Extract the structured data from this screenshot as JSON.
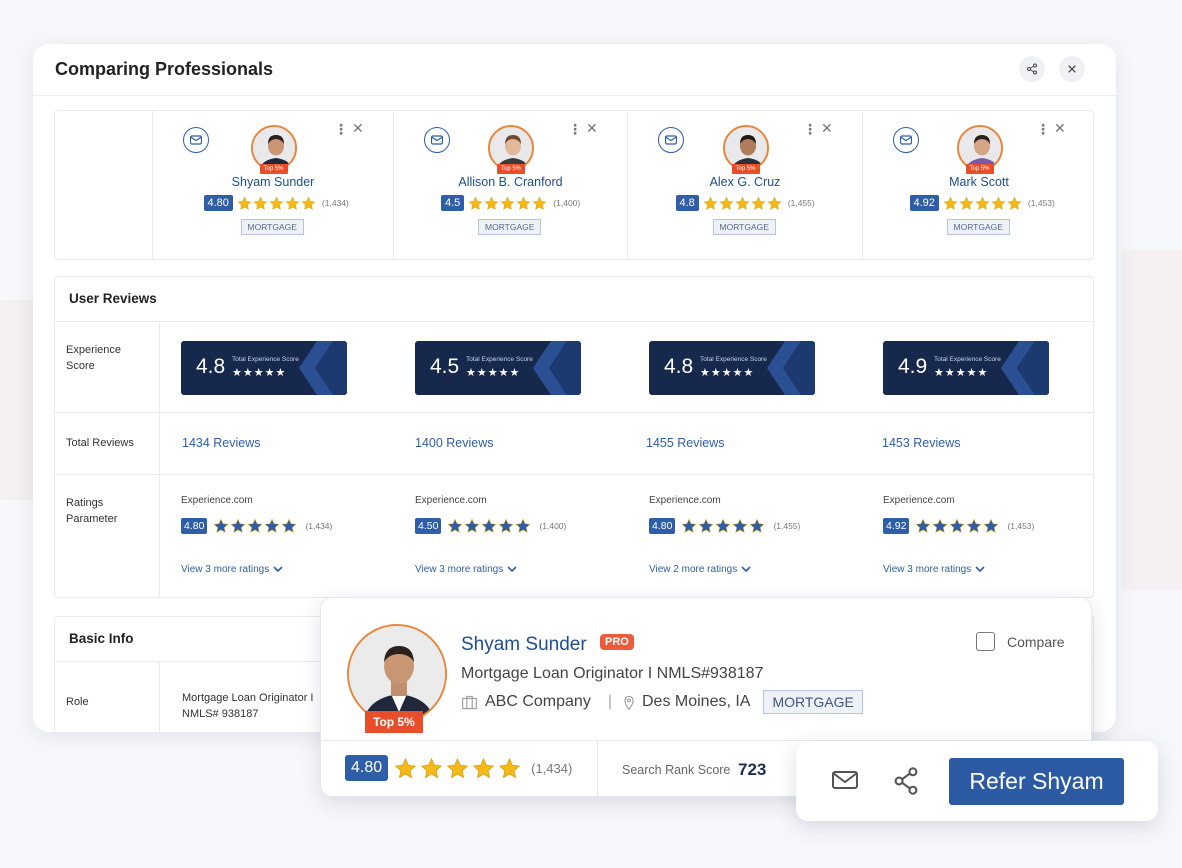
{
  "panel": {
    "title": "Comparing Professionals"
  },
  "colors": {
    "brand_blue": "#2f5ea8",
    "navy": "#16294d",
    "star": "#f5b91a",
    "badge_orange": "#e94e2a"
  },
  "professionals": [
    {
      "name": "Shyam Sunder",
      "badge": "Top 5%",
      "rating": "4.80",
      "reviews_count": "(1,434)",
      "tag": "MORTGAGE",
      "experience_score": "4.8",
      "total_reviews": "1434 Reviews",
      "source": "Experience.com",
      "param_rating": "4.80",
      "param_count": "(1,434)",
      "view_more": "View 3 more ratings"
    },
    {
      "name": "Allison B. Cranford",
      "badge": "Top 5%",
      "rating": "4.5",
      "reviews_count": "(1,400)",
      "tag": "MORTGAGE",
      "experience_score": "4.5",
      "total_reviews": "1400 Reviews",
      "source": "Experience.com",
      "param_rating": "4.50",
      "param_count": "(1,400)",
      "view_more": "View 3 more ratings"
    },
    {
      "name": "Alex G. Cruz",
      "badge": "Top 5%",
      "rating": "4.8",
      "reviews_count": "(1,455)",
      "tag": "MORTGAGE",
      "experience_score": "4.8",
      "total_reviews": "1455 Reviews",
      "source": "Experience.com",
      "param_rating": "4.80",
      "param_count": "(1,455)",
      "view_more": "View 2 more ratings"
    },
    {
      "name": "Mark Scott",
      "badge": "Top 5%",
      "rating": "4.92",
      "reviews_count": "(1,453)",
      "tag": "MORTGAGE",
      "experience_score": "4.9",
      "total_reviews": "1453 Reviews",
      "source": "Experience.com",
      "param_rating": "4.92",
      "param_count": "(1,453)",
      "view_more": "View 3 more ratings"
    }
  ],
  "reviews_section": {
    "title": "User Reviews",
    "row_experience": "Experience Score",
    "row_total": "Total Reviews",
    "row_params": "Ratings Parameter",
    "score_label": "Total Experience Score",
    "score_stars": "★★★★★"
  },
  "basic_section": {
    "title": "Basic Info",
    "row_role": "Role",
    "role_value": "Mortgage Loan Originator I NMLS# 938187"
  },
  "card": {
    "name": "Shyam Sunder",
    "pro": "PRO",
    "badge": "Top 5%",
    "role": "Mortgage Loan Originator I NMLS#938187",
    "company": "ABC Company",
    "location": "Des Moines, IA",
    "tag": "MORTGAGE",
    "compare_label": "Compare",
    "rating": "4.80",
    "reviews_count": "(1,434)",
    "rank_label": "Search Rank Score",
    "rank_value": "723"
  },
  "actions": {
    "refer_label": "Refer Shyam",
    "mail_icon": "mail-icon",
    "share_icon": "share-icon"
  }
}
